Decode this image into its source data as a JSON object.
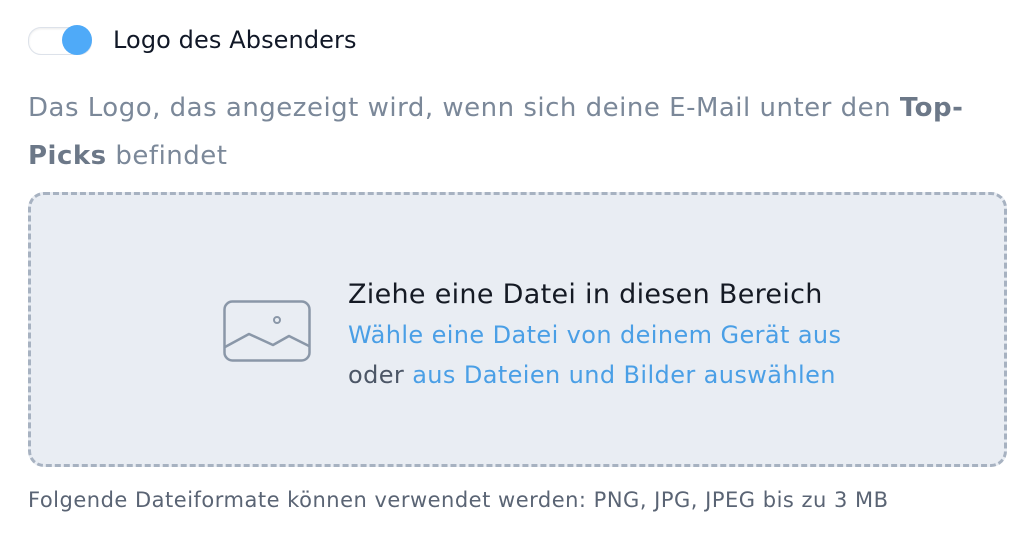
{
  "toggle": {
    "label": "Logo des Absenders",
    "state": "on",
    "knob_color": "#4faaf8"
  },
  "description": {
    "text_before": "Das Logo, das angezeigt wird, wenn sich deine E-Mail unter den ",
    "bold": "Top-Picks",
    "text_after": " befindet"
  },
  "dropzone": {
    "icon": "image-icon",
    "title": "Ziehe eine Datei in diesen Bereich",
    "choose_device_link": "Wähle eine Datei von deinem Gerät aus",
    "or_prefix": "oder",
    "choose_files_link": "aus Dateien und Bilder auswählen"
  },
  "formats_note": "Folgende Dateiformate können verwendet werden: PNG, JPG, JPEG bis zu 3 MB",
  "colors": {
    "link": "#4a9fe6",
    "dropzone_bg": "#e9edf3",
    "dropzone_border": "#a7b2c1"
  }
}
